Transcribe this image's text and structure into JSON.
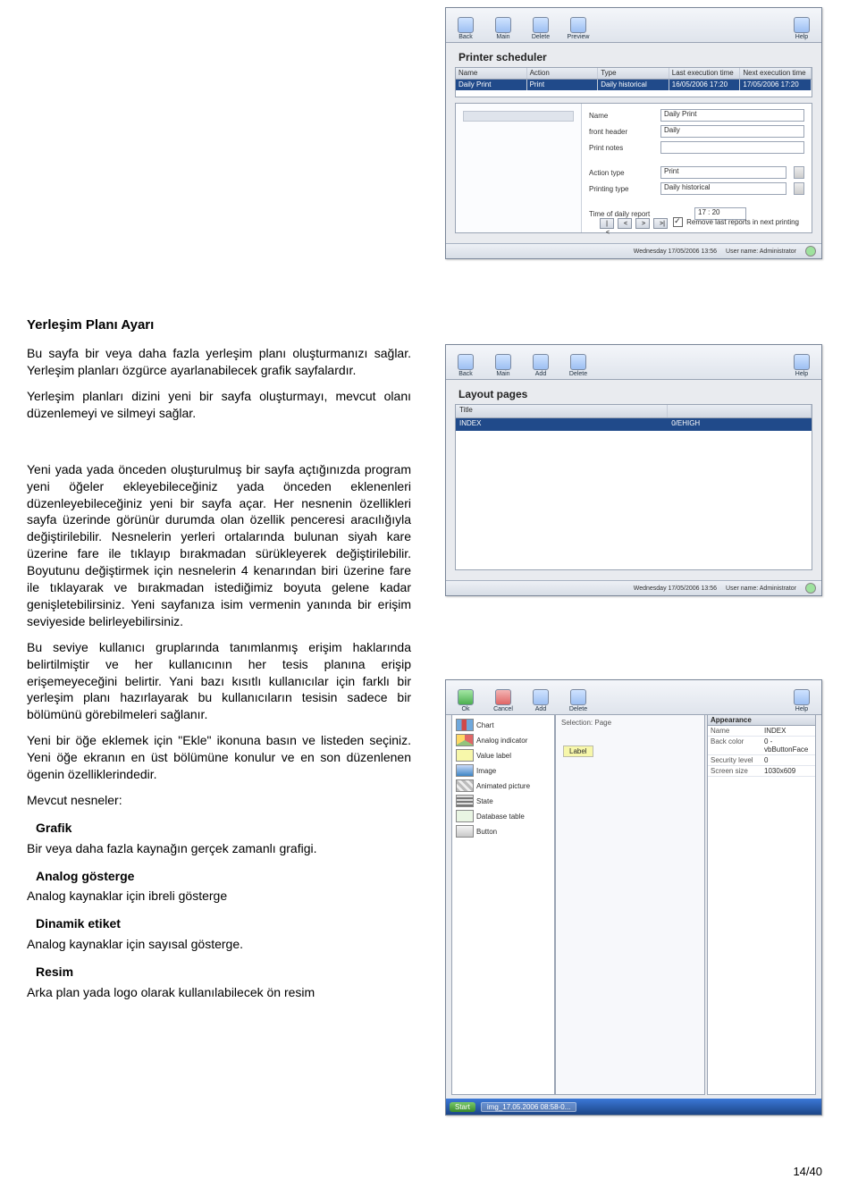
{
  "section_title": "Yerleşim Planı Ayarı",
  "para1": "Bu sayfa bir veya daha fazla yerleşim planı oluşturmanızı sağlar. Yerleşim planları özgürce ayarlanabilecek grafik sayfalardır.",
  "para2": "Yerleşim planları dizini yeni bir sayfa oluşturmayı, mevcut olanı düzenlemeyi ve silmeyi sağlar.",
  "para3": "Yeni yada yada önceden oluşturulmuş bir sayfa açtığınızda program yeni öğeler ekleyebileceğiniz yada önceden eklenenleri düzenleyebileceğiniz yeni bir sayfa açar. Her nesnenin özellikleri sayfa üzerinde görünür durumda olan özellik penceresi aracılığıyla değiştirilebilir. Nesnelerin yerleri ortalarında bulunan siyah kare üzerine fare ile tıklayıp bırakmadan sürükleyerek değiştirilebilir. Boyutunu değiştirmek için nesnelerin 4 kenarından biri üzerine fare ile tıklayarak ve bırakmadan istediğimiz boyuta gelene kadar genişletebilirsiniz. Yeni sayfanıza isim vermenin yanında bir erişim seviyeside belirleyebilirsiniz.",
  "para4": "Bu seviye kullanıcı gruplarında tanımlanmış erişim haklarında belirtilmiştir ve her kullanıcının her tesis planına erişip erişemeyeceğini belirtir. Yani bazı kısıtlı kullanıcılar için farklı bir yerleşim planı hazırlayarak bu kullanıcıların tesisin sadece bir bölümünü görebilmeleri sağlanır.",
  "para5": "Yeni bir öğe eklemek için \"Ekle\" ikonuna basın ve listeden seçiniz. Yeni öğe ekranın en üst bölümüne konulur ve en son düzenlenen ögenin özelliklerindedir.",
  "objects_heading": "Mevcut nesneler:",
  "obj_grafik_title": "Grafik",
  "obj_grafik_desc": "Bir veya daha fazla kaynağın gerçek zamanlı grafigi.",
  "obj_analog_title": "Analog gösterge",
  "obj_analog_desc": "Analog kaynaklar için ibreli gösterge",
  "obj_dinamik_title": "Dinamik etiket",
  "obj_dinamik_desc": "Analog kaynaklar için sayısal gösterge.",
  "obj_resim_title": "Resim",
  "obj_resim_desc": "Arka plan yada logo olarak kullanılabilecek ön resim",
  "page_num": "14/40",
  "toolbar_printer": {
    "btns": [
      "Back",
      "Main",
      "Delete",
      "Preview"
    ],
    "help": "Help"
  },
  "printer": {
    "title": "Printer scheduler",
    "cols": [
      "Name",
      "Action",
      "Type",
      "Last execution time",
      "Next execution time"
    ],
    "row": [
      "Daily Print",
      "Print",
      "Daily historical",
      "16/05/2006 17:20",
      "17/05/2006 17:20"
    ],
    "fields": {
      "name_lbl": "Name",
      "name_val": "Daily Print",
      "hh_lbl": "front header",
      "hh_val": "Daily",
      "pn_lbl": "Print notes",
      "at_lbl": "Action type",
      "at_val": "Print",
      "pt_lbl": "Printing type",
      "pt_val": "Daily historical",
      "time_lbl": "Time of daily report",
      "time_val": "17 : 20",
      "remove_chk": "Remove last reports in next printing"
    },
    "status_day": "Wednesday  17/05/2006   13:56",
    "status_user": "User name: Administrator"
  },
  "toolbar_layout": {
    "btns": [
      "Back",
      "Main",
      "Add",
      "Delete"
    ],
    "help": "Help"
  },
  "layout_pages": {
    "title": "Layout pages",
    "col1": "Title",
    "col2": "",
    "row_title": "INDEX",
    "row_val": "0/EHIGH",
    "status_day": "Wednesday  17/05/2006   13:56",
    "status_user": "User name: Administrator"
  },
  "toolbar_editor": {
    "btns": [
      "Ok",
      "Cancel",
      "Add",
      "Delete"
    ],
    "help": "Help"
  },
  "editor": {
    "items": [
      {
        "lbl": "Chart"
      },
      {
        "lbl": "Analog indicator"
      },
      {
        "lbl": "Value label"
      },
      {
        "lbl": "Image"
      },
      {
        "lbl": "Animated picture"
      },
      {
        "lbl": "State"
      },
      {
        "lbl": "Database table"
      },
      {
        "lbl": "Button"
      }
    ],
    "selection_lbl": "Selection: Page",
    "canvas_label": "Label",
    "props_hdr": "Appearance",
    "props": [
      {
        "k": "Name",
        "v": "INDEX"
      },
      {
        "k": "Back color",
        "v": "0 - vbButtonFace"
      },
      {
        "k": "Security level",
        "v": "0"
      },
      {
        "k": "Screen size",
        "v": "1030x609"
      }
    ],
    "taskbar_start": "Start",
    "taskbar_item": "img_17.05.2006 08:58-0..."
  }
}
